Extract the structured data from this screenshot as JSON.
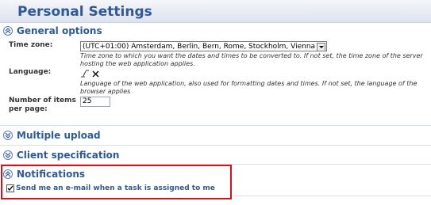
{
  "page": {
    "title": "Personal Settings"
  },
  "sections": {
    "general": {
      "title": "General options"
    },
    "multiple_upload": {
      "title": "Multiple upload"
    },
    "client_spec": {
      "title": "Client specification"
    },
    "notifications": {
      "title": "Notifications"
    }
  },
  "general": {
    "timezone": {
      "label": "Time zone:",
      "value": "(UTC+01:00) Amsterdam, Berlin, Bern, Rome, Stockholm, Vienna",
      "hint": "Time zone to which you want the dates and times to be converted to. If not set, the time zone of the server hosting the web application applies."
    },
    "language": {
      "label": "Language:",
      "hint": "Language of the web application, also used for formatting dates and times. If not set, the language of the browser applies"
    },
    "items_per_page": {
      "label_line1": "Number of items",
      "label_line2": "per page:",
      "value": "25"
    }
  },
  "notifications": {
    "task_email": {
      "label": "Send me an e-mail when a task is assigned to me",
      "checked": true
    }
  },
  "icons": {
    "language_set": "edit-text-icon",
    "language_clear": "clear-x-icon",
    "collapse": "collapse-up-icon",
    "expand": "expand-down-icon"
  },
  "colors": {
    "heading": "#2c5a9c",
    "highlight_border": "#d6111d"
  }
}
